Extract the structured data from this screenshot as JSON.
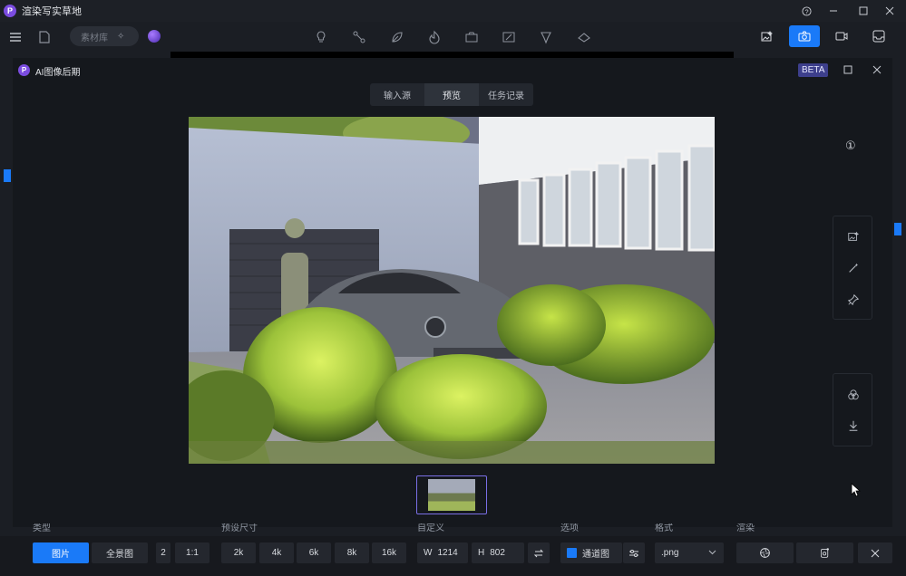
{
  "app": {
    "title": "渲染写实草地",
    "logo_letter": "P"
  },
  "toolbar": {
    "material_pill": "素材库"
  },
  "modal": {
    "title": "AI图像后期",
    "beta": "BETA",
    "tabs": [
      {
        "label": "输入源",
        "active": false
      },
      {
        "label": "预览",
        "active": true
      },
      {
        "label": "任务记录",
        "active": false
      }
    ],
    "info_badge": "①"
  },
  "bottom": {
    "section_labels": [
      "类型",
      "预设尺寸",
      "自定义",
      "选项",
      "格式",
      "渲染"
    ],
    "type_image": "图片",
    "type_panorama": "全景图",
    "ratio_partial": "2",
    "ratio": "1:1",
    "sizes": [
      "2k",
      "4k",
      "6k",
      "8k",
      "16k"
    ],
    "width_label": "W",
    "width_value": "1214",
    "height_label": "H",
    "height_value": "802",
    "channel_label": "通道图",
    "format": ".png"
  },
  "colors": {
    "accent": "#1a7af8",
    "brand": "#7b4ce0",
    "beta_bg": "#3d3f8c"
  }
}
